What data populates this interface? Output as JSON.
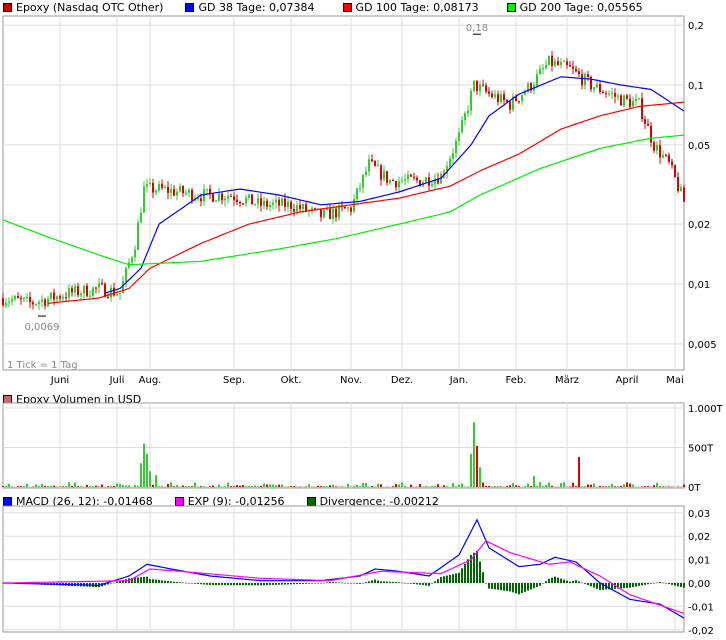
{
  "legend_main": [
    {
      "label": "Epoxy (Nasdaq OTC Other)",
      "color": "#cc0000"
    },
    {
      "label": "GD 38 Tage: 0,07384",
      "color": "#0000ff"
    },
    {
      "label": "GD 100 Tage: 0,08173",
      "color": "#ff0000"
    },
    {
      "label": "GD 200 Tage: 0,05565",
      "color": "#00ee00"
    }
  ],
  "legend_volume": {
    "label": "Epoxy Volumen in USD",
    "color": "#cc6666"
  },
  "legend_macd": [
    {
      "label": "MACD (26, 12): -0,01468",
      "color": "#0000ff"
    },
    {
      "label": "EXP (9): -0,01256",
      "color": "#ff00ff"
    },
    {
      "label": "Divergence: -0,00212",
      "color": "#006600"
    }
  ],
  "tick_note": "1 Tick = 1 Tag",
  "colors": {
    "up": "#33cc33",
    "down": "#dd0000",
    "grid": "#dddddd"
  },
  "chart_data": [
    {
      "type": "candlestick",
      "title": "Epoxy (Nasdaq OTC Other)",
      "yscale": "log",
      "ylim": [
        0.0038,
        0.22
      ],
      "yticks": [
        {
          "v": 0.2,
          "l": "0,2"
        },
        {
          "v": 0.1,
          "l": "0,1"
        },
        {
          "v": 0.05,
          "l": "0,05"
        },
        {
          "v": 0.02,
          "l": "0,02"
        },
        {
          "v": 0.01,
          "l": "0,01"
        },
        {
          "v": 0.005,
          "l": "0,005"
        }
      ],
      "xticks": [
        {
          "d": 19,
          "l": "Juni"
        },
        {
          "d": 38,
          "l": "Juli"
        },
        {
          "d": 49,
          "l": "Aug."
        },
        {
          "d": 77,
          "l": "Sep."
        },
        {
          "d": 96,
          "l": "Okt."
        },
        {
          "d": 116,
          "l": "Nov."
        },
        {
          "d": 133,
          "l": "Dez."
        },
        {
          "d": 152,
          "l": "Jan."
        },
        {
          "d": 171,
          "l": "Feb."
        },
        {
          "d": 188,
          "l": "März"
        },
        {
          "d": 208,
          "l": "April"
        },
        {
          "d": 224,
          "l": "Mai"
        }
      ],
      "days": 228,
      "annotations": [
        {
          "d": 13,
          "price": 0.0069,
          "label": "0,0069"
        },
        {
          "d": 158,
          "price": 0.18,
          "label": "0,18"
        }
      ],
      "price_keypoints": [
        [
          0,
          0.0085
        ],
        [
          9,
          0.008
        ],
        [
          16,
          0.0085
        ],
        [
          22,
          0.009
        ],
        [
          32,
          0.0095
        ],
        [
          39,
          0.009
        ],
        [
          44,
          0.016
        ],
        [
          47,
          0.03
        ],
        [
          52,
          0.03
        ],
        [
          66,
          0.028
        ],
        [
          76,
          0.028
        ],
        [
          86,
          0.025
        ],
        [
          96,
          0.025
        ],
        [
          106,
          0.022
        ],
        [
          116,
          0.024
        ],
        [
          122,
          0.04
        ],
        [
          129,
          0.033
        ],
        [
          139,
          0.033
        ],
        [
          146,
          0.035
        ],
        [
          152,
          0.055
        ],
        [
          157,
          0.1
        ],
        [
          162,
          0.09
        ],
        [
          169,
          0.08
        ],
        [
          176,
          0.1
        ],
        [
          182,
          0.13
        ],
        [
          189,
          0.12
        ],
        [
          196,
          0.1
        ],
        [
          206,
          0.085
        ],
        [
          212,
          0.08
        ],
        [
          217,
          0.05
        ],
        [
          222,
          0.04
        ],
        [
          227,
          0.026
        ]
      ],
      "series": [
        {
          "name": "GD 38",
          "color": "#0000ff",
          "points": [
            [
              34,
              0.009
            ],
            [
              39,
              0.0095
            ],
            [
              46,
              0.012
            ],
            [
              52,
              0.02
            ],
            [
              66,
              0.028
            ],
            [
              79,
              0.03
            ],
            [
              92,
              0.028
            ],
            [
              106,
              0.025
            ],
            [
              119,
              0.026
            ],
            [
              132,
              0.029
            ],
            [
              146,
              0.034
            ],
            [
              156,
              0.05
            ],
            [
              162,
              0.07
            ],
            [
              172,
              0.09
            ],
            [
              186,
              0.11
            ],
            [
              196,
              0.107
            ],
            [
              206,
              0.1
            ],
            [
              216,
              0.095
            ],
            [
              227,
              0.074
            ]
          ]
        },
        {
          "name": "GD 100",
          "color": "#ff0000",
          "points": [
            [
              15,
              0.008
            ],
            [
              32,
              0.0085
            ],
            [
              42,
              0.0095
            ],
            [
              49,
              0.012
            ],
            [
              66,
              0.016
            ],
            [
              82,
              0.02
            ],
            [
              99,
              0.023
            ],
            [
              116,
              0.025
            ],
            [
              132,
              0.027
            ],
            [
              149,
              0.031
            ],
            [
              159,
              0.037
            ],
            [
              172,
              0.045
            ],
            [
              186,
              0.06
            ],
            [
              199,
              0.07
            ],
            [
              212,
              0.078
            ],
            [
              227,
              0.082
            ]
          ]
        },
        {
          "name": "GD 200",
          "color": "#00ee00",
          "points": [
            [
              0,
              0.021
            ],
            [
              16,
              0.017
            ],
            [
              32,
              0.014
            ],
            [
              42,
              0.0125
            ],
            [
              66,
              0.013
            ],
            [
              92,
              0.015
            ],
            [
              112,
              0.017
            ],
            [
              132,
              0.02
            ],
            [
              149,
              0.023
            ],
            [
              159,
              0.028
            ],
            [
              179,
              0.038
            ],
            [
              199,
              0.048
            ],
            [
              216,
              0.054
            ],
            [
              227,
              0.056
            ]
          ]
        }
      ]
    },
    {
      "type": "bar",
      "title": "Epoxy Volumen in USD",
      "ylim": [
        0,
        1000
      ],
      "yticks": [
        {
          "v": 1000,
          "l": "1.000T"
        },
        {
          "v": 500,
          "l": "500T"
        },
        {
          "v": 0,
          "l": "0T"
        }
      ],
      "spikes": [
        [
          46,
          300
        ],
        [
          47,
          550
        ],
        [
          48,
          420
        ],
        [
          49,
          200
        ],
        [
          51,
          150
        ],
        [
          156,
          420
        ],
        [
          157,
          820
        ],
        [
          158,
          520
        ],
        [
          159,
          250
        ],
        [
          192,
          380
        ],
        [
          177,
          140
        ]
      ]
    },
    {
      "type": "line",
      "title": "MACD",
      "ylim": [
        -0.0205,
        0.032
      ],
      "yticks": [
        {
          "v": 0.03,
          "l": "0,03"
        },
        {
          "v": 0.02,
          "l": "0,02"
        },
        {
          "v": 0.01,
          "l": "0,01"
        },
        {
          "v": 0,
          "l": "0,00"
        },
        {
          "v": -0.01,
          "l": "-0,01"
        },
        {
          "v": -0.02,
          "l": "-0,02"
        }
      ],
      "series": [
        {
          "name": "MACD (26, 12)",
          "color": "#0000ff",
          "points": [
            [
              0,
              0
            ],
            [
              32,
              -0.001
            ],
            [
              42,
              0.003
            ],
            [
              48,
              0.008
            ],
            [
              56,
              0.006
            ],
            [
              69,
              0.003
            ],
            [
              86,
              0.001
            ],
            [
              106,
              0.001
            ],
            [
              119,
              0.003
            ],
            [
              124,
              0.006
            ],
            [
              132,
              0.005
            ],
            [
              142,
              0.003
            ],
            [
              152,
              0.012
            ],
            [
              158,
              0.027
            ],
            [
              162,
              0.015
            ],
            [
              172,
              0.007
            ],
            [
              179,
              0.008
            ],
            [
              184,
              0.011
            ],
            [
              191,
              0.009
            ],
            [
              199,
              0
            ],
            [
              209,
              -0.007
            ],
            [
              219,
              -0.009
            ],
            [
              227,
              -0.015
            ]
          ]
        },
        {
          "name": "EXP (9)",
          "color": "#ff00ff",
          "points": [
            [
              0,
              0
            ],
            [
              42,
              0.001
            ],
            [
              49,
              0.006
            ],
            [
              59,
              0.005
            ],
            [
              86,
              0.002
            ],
            [
              109,
              0.001
            ],
            [
              126,
              0.005
            ],
            [
              146,
              0.004
            ],
            [
              156,
              0.01
            ],
            [
              161,
              0.018
            ],
            [
              169,
              0.013
            ],
            [
              182,
              0.008
            ],
            [
              189,
              0.009
            ],
            [
              199,
              0.003
            ],
            [
              209,
              -0.005
            ],
            [
              227,
              -0.013
            ]
          ]
        }
      ]
    }
  ]
}
